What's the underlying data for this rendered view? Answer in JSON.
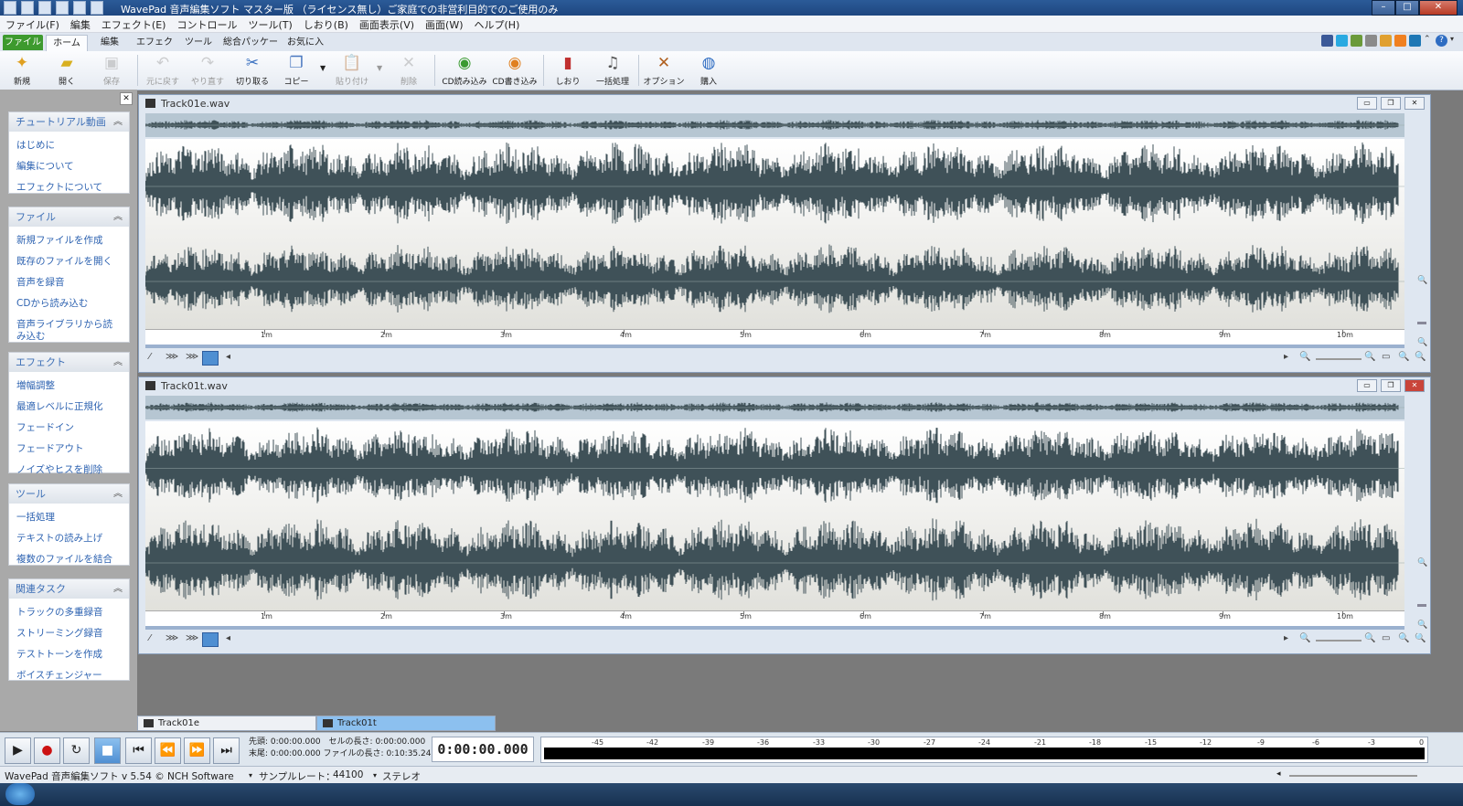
{
  "window": {
    "title": "WavePad 音声編集ソフト マスター版 （ライセンス無し）ご家庭での非営利目的でのご使用のみ"
  },
  "menu": [
    "ファイル(F)",
    "編集",
    "エフェクト(E)",
    "コントロール",
    "ツール(T)",
    "しおり(B)",
    "画面表示(V)",
    "画面(W)",
    "ヘルプ(H)"
  ],
  "tabs": [
    "ファイル",
    "ホーム",
    "編集",
    "エフェクト",
    "ツール",
    "総合パッケージ",
    "お気に入り"
  ],
  "ribbon": [
    {
      "label": "新規",
      "icon": "new-file-icon"
    },
    {
      "label": "開く",
      "icon": "open-folder-icon"
    },
    {
      "label": "保存",
      "icon": "save-icon"
    },
    {
      "label": "元に戻す",
      "icon": "undo-icon"
    },
    {
      "label": "やり直す",
      "icon": "redo-icon"
    },
    {
      "label": "切り取る",
      "icon": "scissors-icon"
    },
    {
      "label": "コピー",
      "icon": "copy-icon"
    },
    {
      "label": "貼り付け",
      "icon": "paste-icon"
    },
    {
      "label": "削除",
      "icon": "delete-icon"
    },
    {
      "label": "CD読み込み",
      "icon": "cd-import-icon"
    },
    {
      "label": "CD書き込み",
      "icon": "cd-burn-icon"
    },
    {
      "label": "しおり",
      "icon": "bookmark-icon"
    },
    {
      "label": "一括処理",
      "icon": "batch-icon"
    },
    {
      "label": "オプション",
      "icon": "options-icon"
    },
    {
      "label": "購入",
      "icon": "purchase-icon"
    }
  ],
  "sidebar": [
    {
      "title": "チュートリアル動画",
      "items": [
        "はじめに",
        "編集について",
        "エフェクトについて"
      ]
    },
    {
      "title": "ファイル",
      "items": [
        "新規ファイルを作成",
        "既存のファイルを開く",
        "音声を録音",
        "CDから読み込む",
        "音声ライブラリから読み込む"
      ]
    },
    {
      "title": "エフェクト",
      "items": [
        "増幅調整",
        "最適レベルに正規化",
        "フェードイン",
        "フェードアウト",
        "ノイズやヒスを削除"
      ]
    },
    {
      "title": "ツール",
      "items": [
        "一括処理",
        "テキストの読み上げ",
        "複数のファイルを結合"
      ]
    },
    {
      "title": "関連タスク",
      "items": [
        "トラックの多重録音",
        "ストリーミング録音",
        "テストトーンを作成",
        "ボイスチェンジャー"
      ]
    }
  ],
  "tracks": [
    {
      "name": "Track01e.wav"
    },
    {
      "name": "Track01t.wav"
    }
  ],
  "ruler_labels": [
    "1m",
    "2m",
    "3m",
    "4m",
    "5m",
    "6m",
    "7m",
    "8m",
    "9m",
    "10m"
  ],
  "file_tabs": [
    "Track01e",
    "Track01t"
  ],
  "transport": {
    "start_label": "先頭:",
    "start_value": "0:00:00.000",
    "end_label": "末尾:",
    "end_value": "0:00:00.000",
    "sel_label": "セルの長さ:",
    "sel_value": "0:00:00.000",
    "file_label": "ファイルの長さ:",
    "file_value": "0:10:35.240",
    "current": "0:00:00.000"
  },
  "meter_labels": [
    "-45",
    "-42",
    "-39",
    "-36",
    "-33",
    "-30",
    "-27",
    "-24",
    "-21",
    "-18",
    "-15",
    "-12",
    "-9",
    "-6",
    "-3",
    "0"
  ],
  "status": {
    "app": "WavePad 音声編集ソフト v 5.54 © NCH Software",
    "rate_label": "サンプルレート：",
    "rate": "44100",
    "channels": "ステレオ"
  },
  "colors": {
    "waveform": "#3f5158",
    "accent": "#3d6fb6",
    "file_tab": "#3d9a2e",
    "active_tab": "#8cc0ef"
  }
}
